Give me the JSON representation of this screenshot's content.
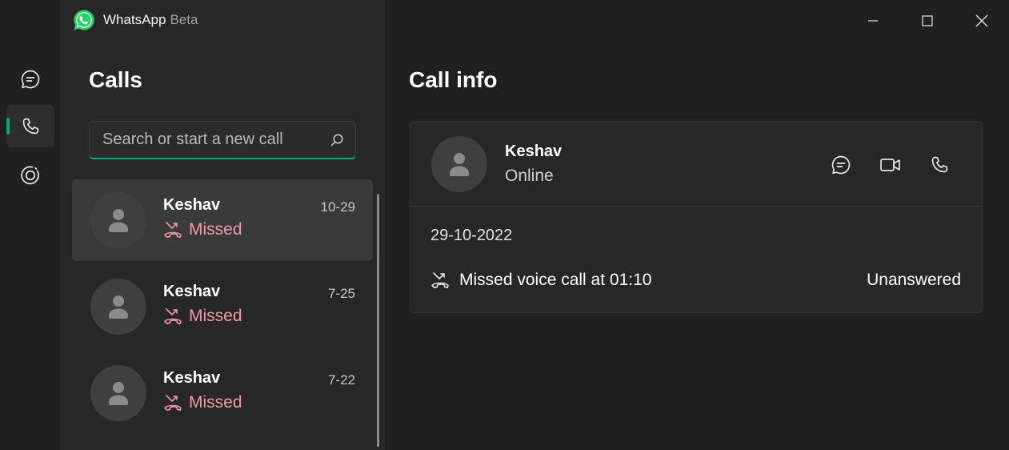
{
  "app": {
    "name": "WhatsApp",
    "badge": "Beta",
    "accent_color": "#00a884",
    "missed_color": "#f09aa8"
  },
  "nav": {
    "items": [
      {
        "icon": "chat-icon",
        "active": false
      },
      {
        "icon": "phone-icon",
        "active": true
      },
      {
        "icon": "status-icon",
        "active": false
      }
    ]
  },
  "calls_pane": {
    "title": "Calls",
    "search": {
      "placeholder": "Search or start a new call",
      "value": ""
    },
    "items": [
      {
        "name": "Keshav",
        "date": "10-29",
        "status": "Missed",
        "selected": true
      },
      {
        "name": "Keshav",
        "date": "7-25",
        "status": "Missed",
        "selected": false
      },
      {
        "name": "Keshav",
        "date": "7-22",
        "status": "Missed",
        "selected": false
      }
    ]
  },
  "call_info": {
    "title": "Call info",
    "contact": {
      "name": "Keshav",
      "presence": "Online"
    },
    "actions": [
      "chat-icon",
      "video-icon",
      "phone-icon"
    ],
    "day": "29-10-2022",
    "entry": {
      "description": "Missed voice call at 01:10",
      "result": "Unanswered"
    }
  },
  "window_controls": [
    "minimize-icon",
    "maximize-icon",
    "close-icon"
  ]
}
